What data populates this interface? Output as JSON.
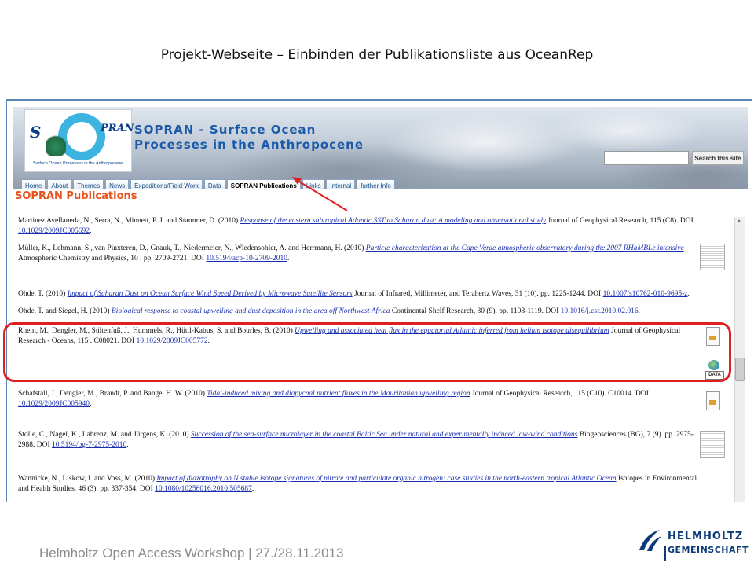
{
  "slide": {
    "title": "Projekt-Webseite – Einbinden der Publikationsliste aus OceanRep",
    "footer": "Helmholtz Open Access Workshop | 27./28.11.2013",
    "org_logo": {
      "line1": "HELMHOLTZ",
      "line2": "GEMEINSCHAFT"
    }
  },
  "site": {
    "logo": {
      "s": "S",
      "pran": "PRAN",
      "tagline": "Surface Ocean Processes in the Anthropocene"
    },
    "title_line1": "SOPRAN - Surface Ocean",
    "title_line2": "Processes in the Anthropocene",
    "search": {
      "value": "",
      "button_label": "Search this site"
    },
    "tabs": [
      {
        "label": "Home"
      },
      {
        "label": "About"
      },
      {
        "label": "Themes"
      },
      {
        "label": "News"
      },
      {
        "label": "Expeditions/Field Work"
      },
      {
        "label": "Data"
      },
      {
        "label": "SOPRAN Publications",
        "active": true
      },
      {
        "label": "Links"
      },
      {
        "label": "Internal"
      },
      {
        "label": "further Info"
      }
    ],
    "page_heading": "SOPRAN Publications"
  },
  "publications": [
    {
      "prefix": "Martinez Avellaneda, N., Serra, N., Minnett, P. J. and Stammer, D. (2010) ",
      "title": "Response of the eastern subtropical Atlantic SST to Saharan dust: A modeling and observational study",
      "journal": " Journal of Geophysical Research, 115 (C8). DOI ",
      "doi": "10.1029/2009JC005692",
      "suffix": "."
    },
    {
      "prefix": "Müller, K., Lehmann, S., van Pinxteren, D., Gnauk, T., Niedermeier, N., Wiedensohler, A. and Herrmann, H. (2010) ",
      "title": "Particle characterization at the Cape Verde atmospheric observatory during the 2007 RHaMBLe intensive",
      "journal": " Atmospheric Chemistry and Physics, 10 . pp. 2709-2721. DOI ",
      "doi": "10.5194/acp-10-2709-2010",
      "suffix": "."
    },
    {
      "prefix": "Ohde, T. (2010) ",
      "title": "Impact of Saharan Dust on Ocean Surface Wind Speed Derived by Microwave Satellite Sensors",
      "journal": " Journal of Infrared, Millimeter, and Terahertz Waves, 31 (10). pp. 1225-1244. DOI ",
      "doi": "10.1007/s10762-010-9695-z",
      "suffix": "."
    },
    {
      "prefix": "Ohde, T. and Siegel, H. (2010) ",
      "title": "Biological response to coastal upwelling and dust deposition in the area off Northwest Africa",
      "journal": " Continental Shelf Research, 30 (9). pp. 1108-1119. DOI ",
      "doi": "10.1016/j.csr.2010.02.016",
      "suffix": "."
    },
    {
      "prefix": "Rhein, M., Dengler, M., Sültenfuß, J., Hummels, R., Hüttl-Kabus, S. and Bourles, B. (2010) ",
      "title": "Upwelling and associated heat flux in the equatorial Atlantic inferred from helium isotope disequilibrium",
      "journal": " Journal of Geophysical Research - Oceans, 115 . C08021. DOI ",
      "doi": "10.1029/2009JC005772",
      "suffix": ".",
      "data_label": "DATA"
    },
    {
      "prefix": "Schafstall, J., Dengler, M., Brandt, P. and Bange, H. W. (2010) ",
      "title": "Tidal-induced mixing and diapycnal nutrient fluxes in the Mauritanian upwelling region",
      "journal": " Journal of Geophysical Research, 115 (C10). C10014. DOI ",
      "doi": "10.1029/2009JC005940",
      "suffix": "."
    },
    {
      "prefix": "Stolle, C., Nagel, K., Labrenz, M. and Jürgens, K. (2010) ",
      "title": "Succession of the sea-surface microlayer in the coastal Baltic Sea under natural and experimentally induced low-wind conditions",
      "journal": " Biogeosciences (BG), 7 (9). pp. 2975-2988. DOI ",
      "doi": "10.5194/bg-7-2975-2010",
      "suffix": "."
    },
    {
      "prefix": "Wannicke, N., Liskow, I. and Voss, M. (2010) ",
      "title": "Impact of diazotrophy on N stable isotope signatures of nitrate and particulate organic nitrogen: case studies in the north-eastern tropical Atlantic Ocean",
      "journal": " Isotopes in Environmental and Health Studies, 46 (3). pp. 337-354. DOI ",
      "doi": "10.1080/10256016.2010.505687",
      "suffix": "."
    }
  ],
  "colors": {
    "highlight": "#e02020",
    "link": "#1a2fb0",
    "heading": "#e8511b",
    "tab_text": "#1a4f8a"
  }
}
